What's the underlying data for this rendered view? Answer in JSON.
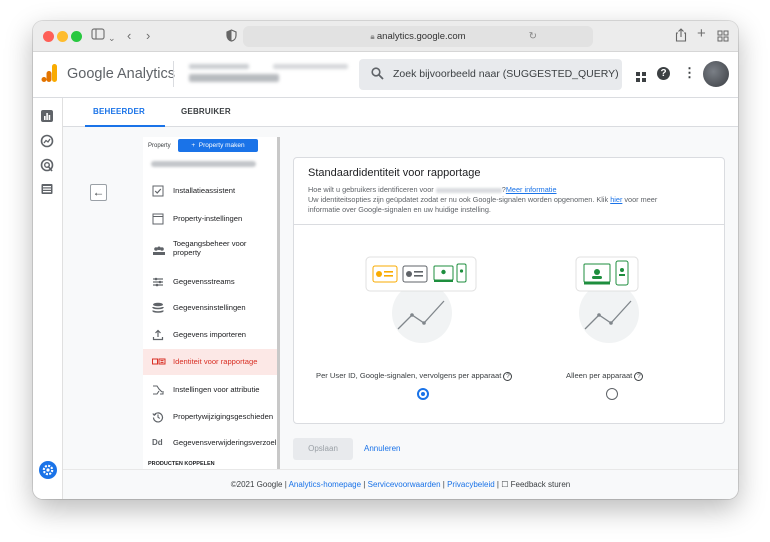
{
  "browser": {
    "url": "analytics.google.com"
  },
  "app": {
    "name": "Google Analytics",
    "search_placeholder": "Zoek bijvoorbeeld naar (SUGGESTED_QUERY)"
  },
  "tabs": [
    {
      "label": "BEHEERDER",
      "active": true
    },
    {
      "label": "GEBRUIKER",
      "active": false
    }
  ],
  "sidebar": {
    "property_label": "Property",
    "create_button": "+  Property maken",
    "items": [
      {
        "label": "Installatieassistent",
        "icon": "checkbox-icon"
      },
      {
        "label": "Property-instellingen",
        "icon": "window-icon"
      },
      {
        "label": "Toegangsbeheer voor property",
        "icon": "people-icon"
      },
      {
        "label": "Gegevensstreams",
        "icon": "streams-icon"
      },
      {
        "label": "Gegevensinstellingen",
        "icon": "database-icon"
      },
      {
        "label": "Gegevens importeren",
        "icon": "upload-icon"
      },
      {
        "label": "Identiteit voor rapportage",
        "icon": "identity-icon",
        "active": true
      },
      {
        "label": "Instellingen voor attributie",
        "icon": "attribution-icon"
      },
      {
        "label": "Propertywijzigingsgeschieden",
        "icon": "history-icon"
      },
      {
        "label": "Gegevensverwijderingsverzoel",
        "icon": "dd-icon"
      }
    ],
    "section_heading": "PRODUCTEN KOPPELEN"
  },
  "card": {
    "title": "Standaardidentiteit voor rapportage",
    "line1_prefix": "Hoe wilt u gebruikers identificeren voor",
    "line1_link": "Meer informatie",
    "line2_prefix": "Uw identiteitsopties zijn geüpdatet zodat er nu ook Google-signalen worden opgenomen. Klik",
    "line2_link": "hier",
    "line2_suffix": "voor meer",
    "line3": "informatie over Google-signalen en uw huidige instelling.",
    "option1": {
      "label": "Per User ID, Google-signalen, vervolgens per apparaat",
      "selected": true
    },
    "option2": {
      "label": "Alleen per apparaat",
      "selected": false
    }
  },
  "actions": {
    "save": "Opslaan",
    "cancel": "Annuleren"
  },
  "footer": {
    "copyright": "©2021 Google",
    "sep": "|",
    "link1": "Analytics-homepage",
    "link2": "Servicevoorwaarden",
    "link3": "Privacybeleid",
    "feedback": "Feedback sturen"
  },
  "colors": {
    "accent": "#1a73e8",
    "active_red": "#d93025",
    "analytics_orange": "#f9ab00",
    "analytics_dark": "#e37400"
  }
}
